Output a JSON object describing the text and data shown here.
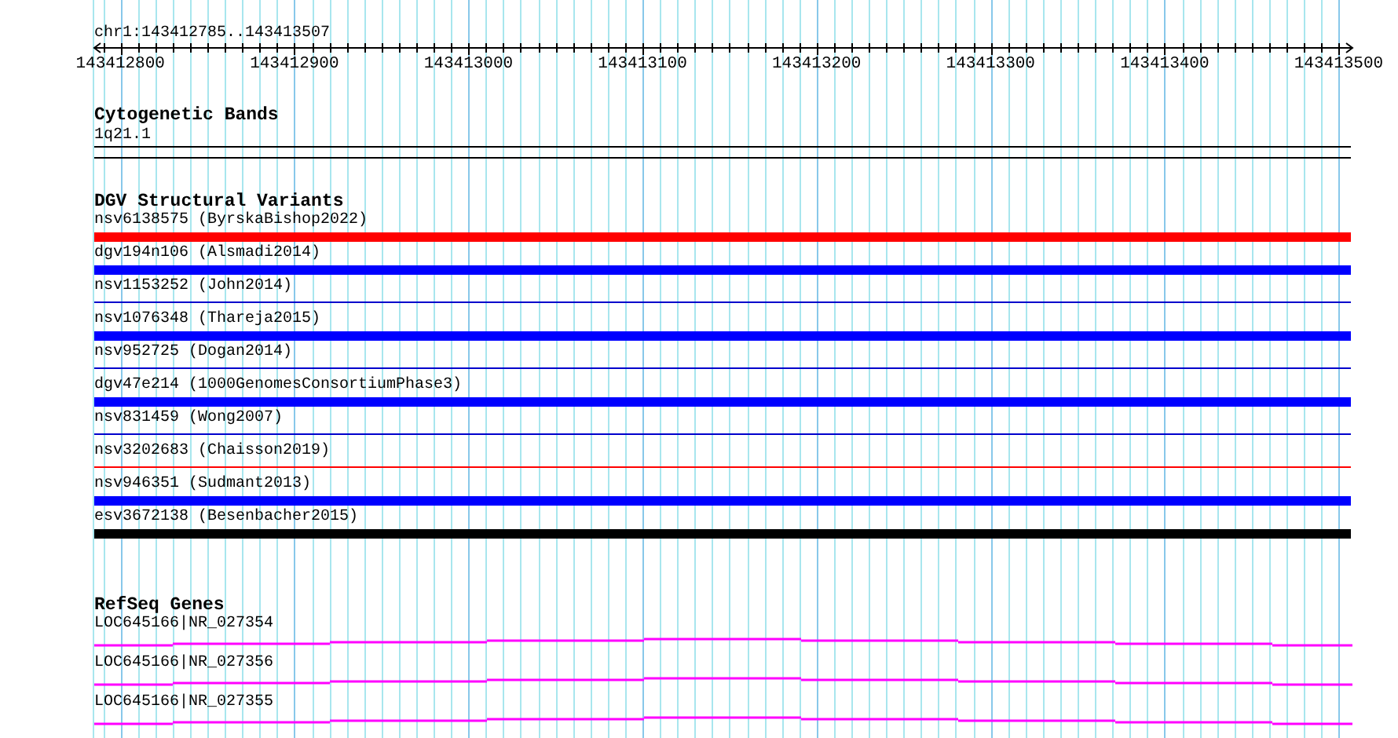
{
  "ruler": {
    "label": "chr1:143412785..143413507",
    "ticks": [
      "143412800",
      "143412900",
      "143413000",
      "143413100",
      "143413200",
      "143413300",
      "143413400",
      "143413500"
    ]
  },
  "tracks": [
    {
      "kind": "bands",
      "title": "Cytogenetic Bands",
      "features": [
        {
          "label": "1q21.1"
        }
      ]
    },
    {
      "kind": "variants",
      "title": "DGV Structural Variants",
      "features": [
        {
          "label": "nsv6138575 (ByrskaBishop2022)",
          "kind": "thick",
          "color": "#ff0000"
        },
        {
          "label": "dgv194n106 (Alsmadi2014)",
          "kind": "thick",
          "color": "#0000ff"
        },
        {
          "label": "nsv1153252 (John2014)",
          "kind": "thin",
          "color": "#0000cc"
        },
        {
          "label": "nsv1076348 (Thareja2015)",
          "kind": "thick",
          "color": "#0000ff"
        },
        {
          "label": "nsv952725 (Dogan2014)",
          "kind": "thin",
          "color": "#0000cc"
        },
        {
          "label": "dgv47e214 (1000GenomesConsortiumPhase3)",
          "kind": "thick",
          "color": "#0000ff"
        },
        {
          "label": "nsv831459 (Wong2007)",
          "kind": "thin",
          "color": "#0000cc"
        },
        {
          "label": "nsv3202683 (Chaisson2019)",
          "kind": "thin",
          "color": "#ff0000"
        },
        {
          "label": "nsv946351 (Sudmant2013)",
          "kind": "thick",
          "color": "#0000ff"
        },
        {
          "label": "esv3672138 (Besenbacher2015)",
          "kind": "thick",
          "color": "#000000"
        }
      ]
    },
    {
      "kind": "genes",
      "title": "RefSeq Genes",
      "features": [
        {
          "label": "LOC645166|NR_027354"
        },
        {
          "label": "LOC645166|NR_027356"
        },
        {
          "label": "LOC645166|NR_027355"
        }
      ]
    }
  ]
}
